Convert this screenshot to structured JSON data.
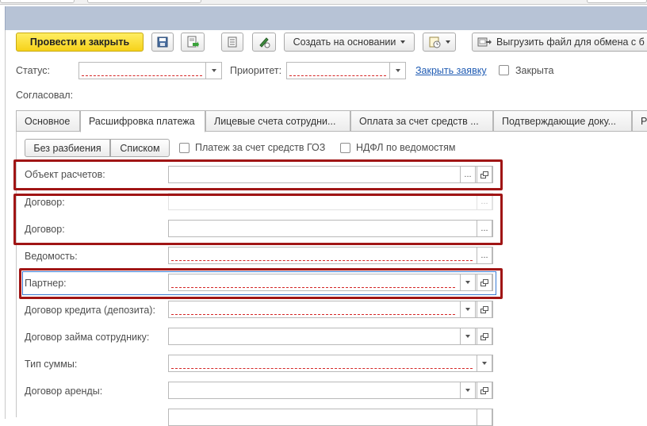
{
  "toolbar": {
    "post_and_close": "Провести и закрыть",
    "create_based_on": "Создать на основании",
    "export_file": "Выгрузить файл для обмена с б"
  },
  "header": {
    "status_label": "Статус:",
    "priority_label": "Приоритет:",
    "close_request_link": "Закрыть заявку",
    "closed_label": "Закрыта",
    "approved_by_label": "Согласовал:"
  },
  "tabs": [
    {
      "label": "Основное"
    },
    {
      "label": "Расшифровка платежа"
    },
    {
      "label": "Лицевые счета сотрудни..."
    },
    {
      "label": "Оплата за счет средств ..."
    },
    {
      "label": "Подтверждающие доку..."
    },
    {
      "label": "Р"
    }
  ],
  "breakdown": {
    "no_split": "Без разбиения",
    "as_list": "Списком",
    "goz_payment": "Платеж за счет средств ГОЗ",
    "ndfl_statements": "НДФЛ по ведомостям"
  },
  "fields": {
    "settlement_object": "Объект расчетов:",
    "contract_1": "Договор:",
    "contract_2": "Договор:",
    "statement": "Ведомость:",
    "partner": "Партнер:",
    "credit_contract": "Договор кредита (депозита):",
    "employee_loan": "Договор займа сотруднику:",
    "amount_type": "Тип суммы:",
    "lease_contract": "Договор аренды:"
  },
  "icons": {
    "ellipsis": "...",
    "save": "save-icon",
    "post": "post-icon",
    "list": "list-icon",
    "sign": "sign-icon",
    "history": "history-icon",
    "export": "export-icon"
  },
  "colors": {
    "primary_button": "#f6d21a",
    "highlight_box": "#a01515",
    "link": "#1f5bb3",
    "title_bar": "#b7c3d6"
  }
}
